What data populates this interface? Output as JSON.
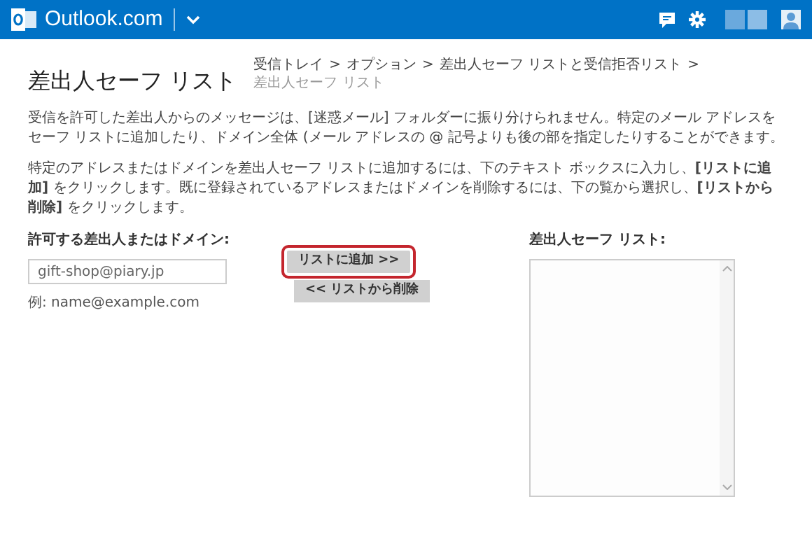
{
  "header": {
    "brand": "Outlook.com"
  },
  "page": {
    "title": "差出人セーフ リスト",
    "breadcrumb": [
      {
        "label": "受信トレイ",
        "current": false
      },
      {
        "label": "オプション",
        "current": false
      },
      {
        "label": "差出人セーフ リストと受信拒否リスト",
        "current": false
      },
      {
        "label": "差出人セーフ リスト",
        "current": true
      }
    ],
    "separator": ">"
  },
  "paragraphs": [
    "受信を許可した差出人からのメッセージは、[迷惑メール] フォルダーに振り分けられません。特定のメール アドレスをセーフ リストに追加したり、ドメイン全体 (メール アドレスの @ 記号よりも後の部を指定したりすることができます。",
    "特定のアドレスまたはドメインを差出人セーフ リストに追加するには、下のテキスト ボックスに入力し、**[リストに追加]** をクリックします。既に登録されているアドレスまたはドメインを削除するには、下の覧から選択し、**[リストから削除]** をクリックします。"
  ],
  "sender_field": {
    "label": "許可する差出人またはドメイン:",
    "value": "gift-shop@piary.jp",
    "example": "例: name@example.com"
  },
  "buttons": [
    {
      "label": "リストに追加 >>",
      "highlighted": true
    },
    {
      "label": "<< リストから削除",
      "highlighted": false
    }
  ],
  "safe_list": {
    "label": "差出人セーフ リスト:"
  }
}
